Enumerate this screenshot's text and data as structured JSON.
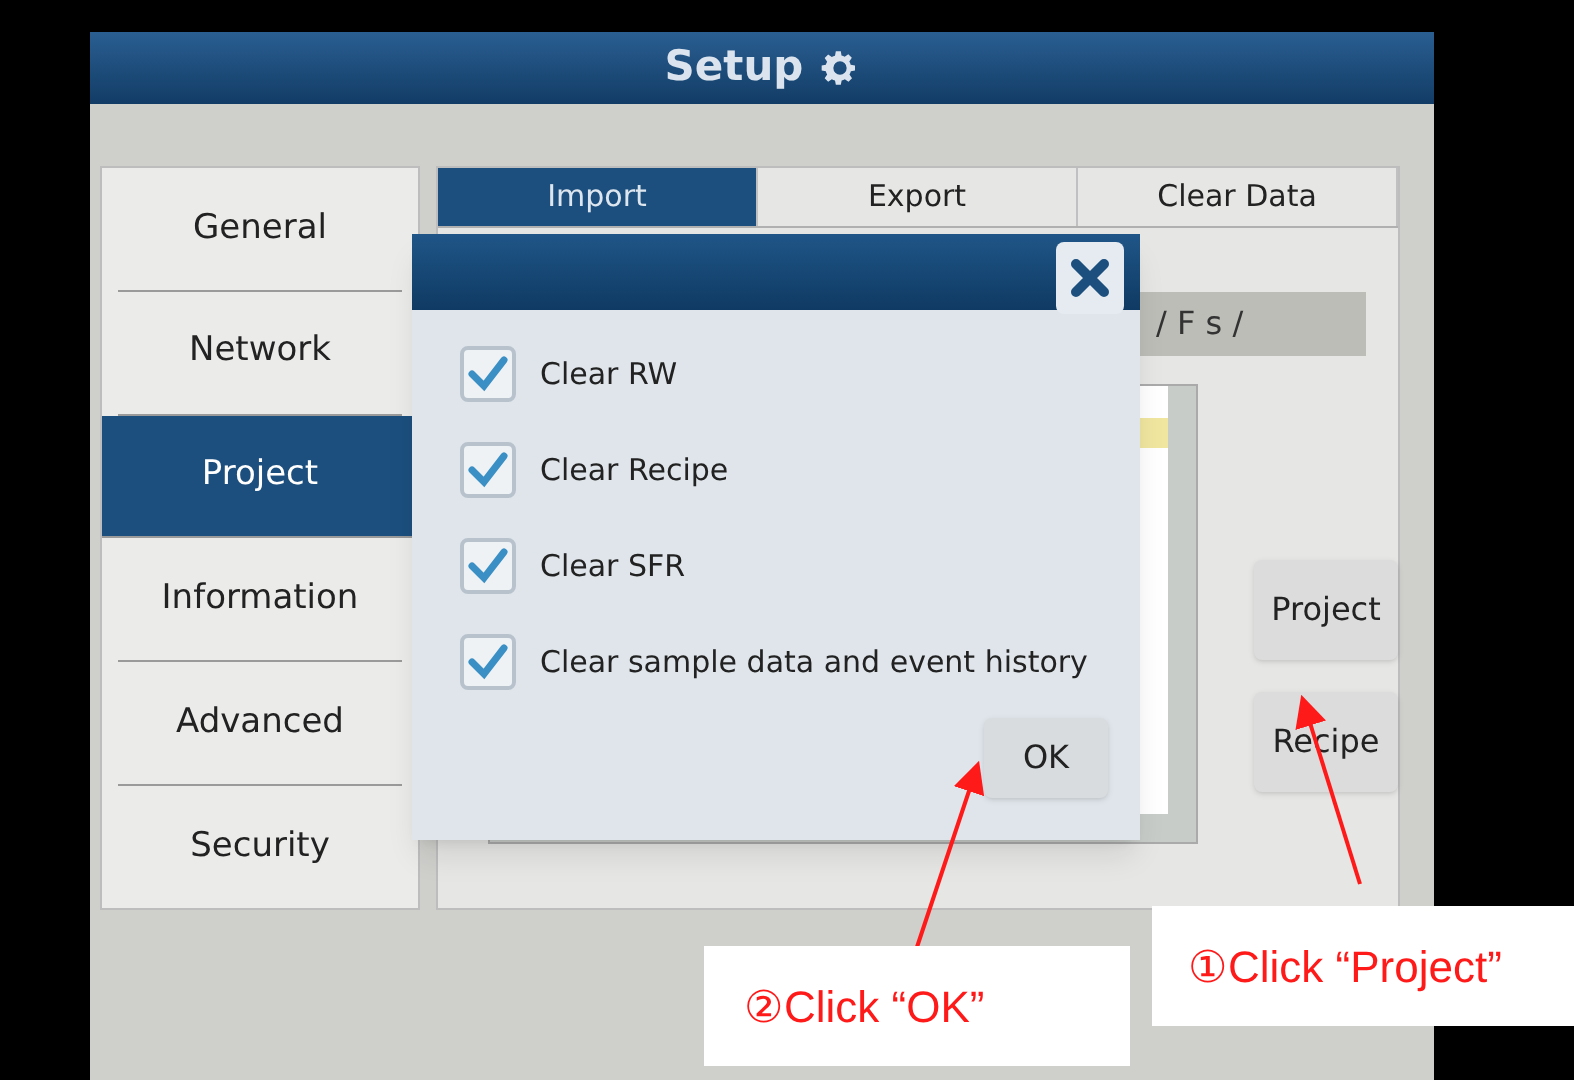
{
  "window": {
    "title": "Setup"
  },
  "sidebar": {
    "items": [
      {
        "label": "General",
        "selected": false
      },
      {
        "label": "Network",
        "selected": false
      },
      {
        "label": "Project",
        "selected": true
      },
      {
        "label": "Information",
        "selected": false
      },
      {
        "label": "Advanced",
        "selected": false
      },
      {
        "label": "Security",
        "selected": false
      }
    ]
  },
  "tabs": [
    {
      "label": "Import",
      "selected": true
    },
    {
      "label": "Export",
      "selected": false
    },
    {
      "label": "Clear Data",
      "selected": false
    }
  ],
  "path_field": {
    "value": "/ F s /"
  },
  "buttons": [
    "Project",
    "Recipe"
  ],
  "dialog": {
    "options": [
      {
        "label": "Clear RW",
        "checked": true
      },
      {
        "label": "Clear Recipe",
        "checked": true
      },
      {
        "label": "Clear SFR",
        "checked": true
      },
      {
        "label": "Clear sample data and event history",
        "checked": true
      }
    ],
    "ok_button": "OK"
  },
  "annotations": [
    {
      "text": "①Click “Project”"
    },
    {
      "text": "②Click “OK”"
    }
  ]
}
